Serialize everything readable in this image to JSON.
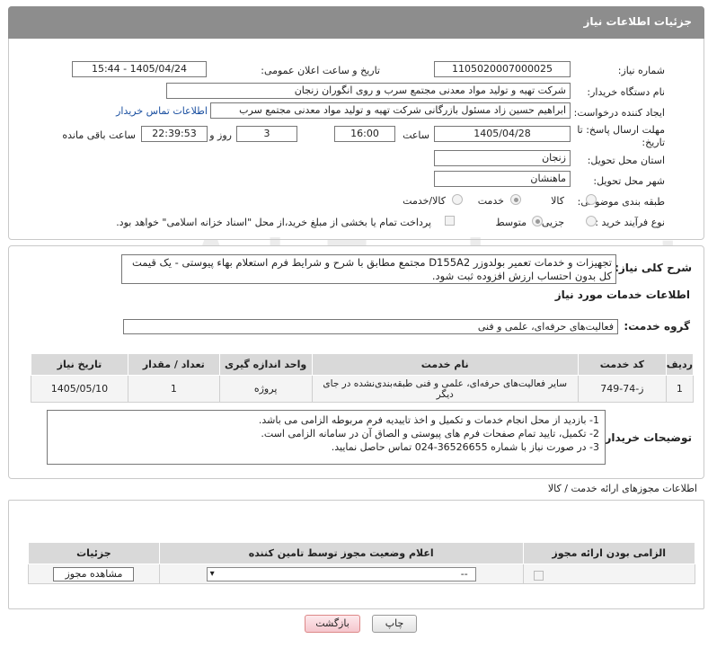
{
  "header": {
    "title": "جزئیات اطلاعات نیاز"
  },
  "fields": {
    "need_number_label": "شماره نیاز:",
    "need_number": "1105020007000025",
    "announce_label": "تاریخ و ساعت اعلان عمومی:",
    "announce_value": "1405/04/24 - 15:44",
    "buyer_org_label": "نام دستگاه خریدار:",
    "buyer_org": "شرکت تهیه و تولید مواد معدنی مجتمع سرب و روی انگوران   زنجان",
    "creator_label": "ایجاد کننده درخواست:",
    "creator": "ابراهیم حسین زاد مسئول بازرگانی شرکت تهیه و تولید مواد معدنی مجتمع سرب",
    "contact_link": "اطلاعات تماس خریدار",
    "deadline_label": "مهلت ارسال پاسخ: تا تاریخ:",
    "deadline_date": "1405/04/28",
    "time_label": "ساعت",
    "deadline_time": "16:00",
    "days_label": "روز و",
    "days_value": "3",
    "remaining_time": "22:39:53",
    "remaining_label": "ساعت باقی مانده",
    "province_label": "استان محل تحویل:",
    "province": "زنجان",
    "city_label": "شهر محل تحویل:",
    "city": "ماهنشان",
    "category_label": "طبقه بندی موضوعی:",
    "category_options": [
      "کالا",
      "خدمت",
      "کالا/خدمت"
    ],
    "process_label": "نوع فرآیند خرید :",
    "process_options": [
      "جزیی",
      "متوسط"
    ],
    "payment_note": "پرداخت تمام یا بخشی از مبلغ خرید،از محل \"اسناد خزانه اسلامی\" خواهد بود."
  },
  "summary": {
    "label": "شرح کلی نیاز:",
    "text": "تجهیزات و خدمات تعمیر بولدوزر D155A2 مجتمع مطابق با شرح و شرایط فرم استعلام بهاء پیوستی - یک قیمت کل بدون احتساب ارزش افزوده ثبت شود."
  },
  "services": {
    "section_title": "اطلاعات خدمات مورد نیاز",
    "group_label": "گروه خدمت:",
    "group_value": "فعالیت‌های حرفه‌ای، علمی و فنی",
    "columns": [
      "ردیف",
      "کد خدمت",
      "نام خدمت",
      "واحد اندازه گیری",
      "تعداد / مقدار",
      "تاریخ نیاز"
    ],
    "rows": [
      {
        "row": "1",
        "code": "ز-74-749",
        "name": "سایر فعالیت‌های حرفه‌ای، علمی و فنی طبقه‌بندی‌نشده در جای دیگر",
        "unit": "پروژه",
        "qty": "1",
        "date": "1405/05/10"
      }
    ]
  },
  "buyer_notes": {
    "label": "توضیحات خریدار:",
    "lines": [
      "1- بازدید از محل انجام خدمات و تکمیل و اخذ تاییدیه فرم مربوطه الزامی می باشد.",
      "2- تکمیل، تایید تمام صفحات فرم های پیوستی و الصاق آن در سامانه الزامی است.",
      "3- در صورت نیاز با شماره 36526655-024 تماس حاصل نمایید."
    ]
  },
  "permits": {
    "section_title": "اطلاعات مجوزهای ارائه خدمت / کالا",
    "columns": [
      "الزامی بودن ارائه مجوز",
      "اعلام وضعیت مجوز توسط تامین کننده",
      "جزئیات"
    ],
    "select_value": "--",
    "view_button": "مشاهده مجوز"
  },
  "buttons": {
    "print": "چاپ",
    "back": "بازگشت"
  },
  "watermark": "AriaTender.net"
}
